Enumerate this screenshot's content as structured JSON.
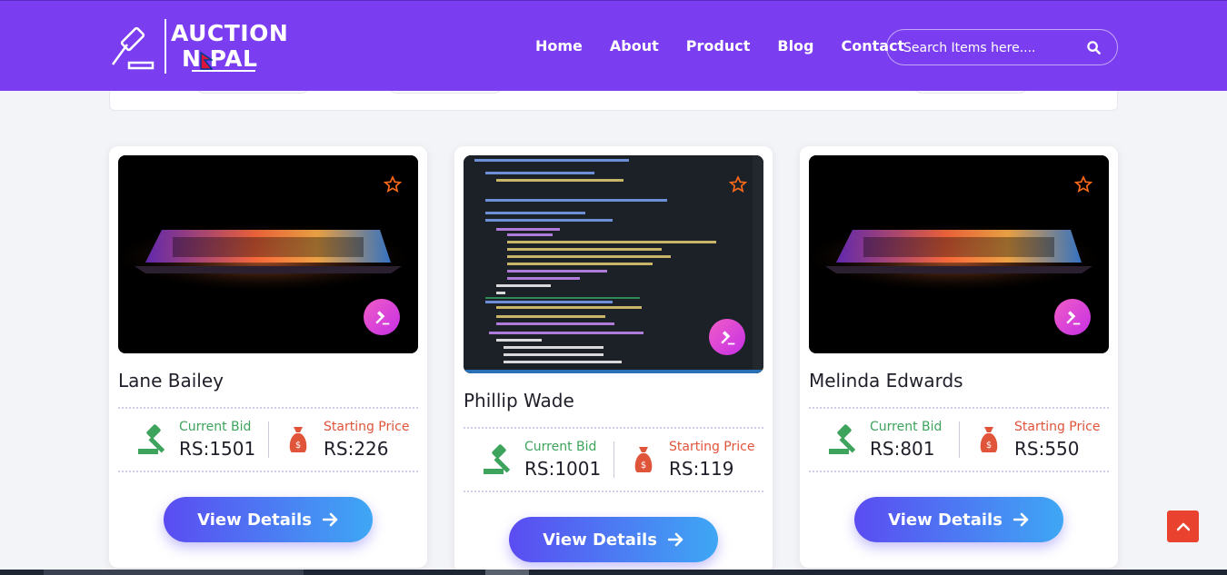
{
  "brand": {
    "line1": "AUCTION",
    "line2": "N PAL"
  },
  "nav": [
    "Home",
    "About",
    "Product",
    "Blog",
    "Contact"
  ],
  "search": {
    "placeholder": "Search Items here...."
  },
  "products": [
    {
      "title": "Lane Bailey",
      "current_label": "Current Bid",
      "current_value": "RS:1501",
      "starting_label": "Starting Price",
      "starting_value": "RS:226",
      "button": "View Details"
    },
    {
      "title": "Phillip Wade",
      "current_label": "Current Bid",
      "current_value": "RS:1001",
      "starting_label": "Starting Price",
      "starting_value": "RS:119",
      "button": "View Details"
    },
    {
      "title": "Melinda Edwards",
      "current_label": "Current Bid",
      "current_value": "RS:801",
      "starting_label": "Starting Price",
      "starting_value": "RS:550",
      "button": "View Details"
    }
  ],
  "colors": {
    "header": "#7b3df0",
    "accent_pink": "#d93de0",
    "bid_green": "#3da35d",
    "price_red": "#e0543a",
    "scroll_top": "#e9432f"
  },
  "icons": {
    "search": "search-icon",
    "favorite": "star-icon",
    "bid": "gavel-icon",
    "price": "money-bag-icon",
    "arrow": "arrow-right-icon",
    "top": "chevron-up-icon"
  }
}
